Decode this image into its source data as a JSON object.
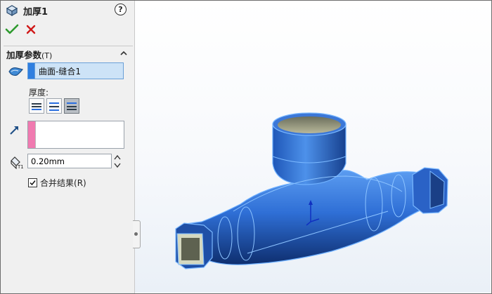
{
  "header": {
    "title": "加厚1",
    "icon": "thicken-feature-icon",
    "help_icon": "help-icon"
  },
  "actions": {
    "ok_icon": "checkmark-icon",
    "cancel_icon": "close-icon"
  },
  "section": {
    "title": "加厚参数",
    "hotkey": "(T)",
    "expanded": true
  },
  "face_selection": {
    "value": "曲面-缝合1",
    "icon": "surface-icon"
  },
  "thickness": {
    "label": "厚度:",
    "options": [
      "thicken-side-1-icon",
      "thicken-both-sides-icon",
      "thicken-side-2-icon"
    ],
    "selected_index": 2
  },
  "direction": {
    "icon": "direction-arrow-icon",
    "value": ""
  },
  "offset": {
    "icon": "thickness-icon",
    "value": "0.20mm"
  },
  "merge_result": {
    "label": "合并结果",
    "hotkey": "(R)",
    "checked": true
  },
  "colors": {
    "model_blue": "#2a6fe0",
    "selection_highlight": "#cde3f7",
    "face_swatch": "#2f7fe0",
    "direction_swatch": "#f07ab0",
    "ok_green": "#2e9a2e",
    "cancel_red": "#d01818"
  }
}
